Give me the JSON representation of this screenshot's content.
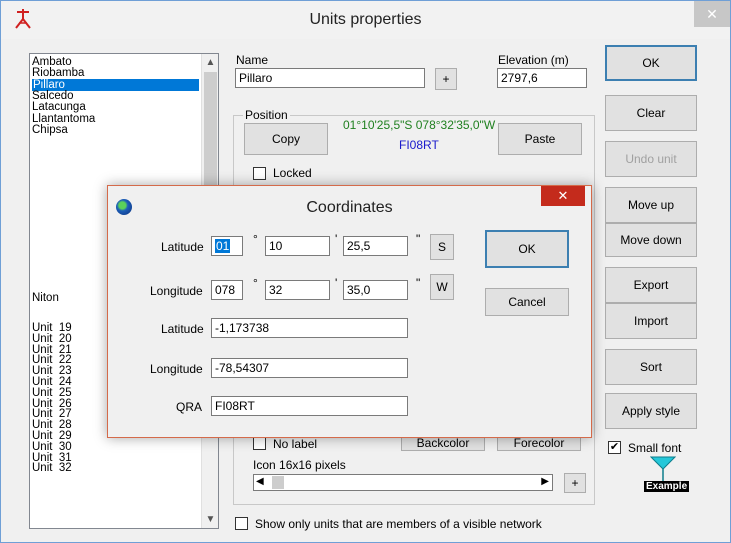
{
  "window": {
    "title": "Units properties",
    "close_glyph": "✕"
  },
  "unit_list": {
    "top_items": [
      "Ambato",
      "Riobamba",
      "Pillaro",
      "Salcedo",
      "Latacunga",
      "Llantantoma",
      "Chipsa"
    ],
    "selected_index": 2,
    "middle_item": "Niton",
    "units": [
      "Unit  19",
      "Unit  20",
      "Unit  21",
      "Unit  22",
      "Unit  23",
      "Unit  24",
      "Unit  25",
      "Unit  26",
      "Unit  27",
      "Unit  28",
      "Unit  29",
      "Unit  30",
      "Unit  31",
      "Unit  32"
    ]
  },
  "form": {
    "name_label": "Name",
    "name_value": "Pillaro",
    "name_plus": "+",
    "elevation_label": "Elevation (m)",
    "elevation_value": "2797,6",
    "position_group": "Position",
    "position_coords": "01°10'25,5\"S 078°32'35,0\"W",
    "position_qra": "FI08RT",
    "copy_label": "Copy",
    "paste_label": "Paste",
    "locked_label": "Locked",
    "no_label": "No label",
    "backcolor_label": "Backcolor",
    "forecolor_label": "Forecolor",
    "icon_label": "Icon 16x16 pixels",
    "icon_plus": "+",
    "show_only_label": "Show only units that are members of a visible network"
  },
  "right_buttons": {
    "ok": "OK",
    "clear": "Clear",
    "undo": "Undo unit",
    "move_up": "Move up",
    "move_down": "Move down",
    "export": "Export",
    "import": "Import",
    "sort": "Sort",
    "apply_style": "Apply style"
  },
  "small_font": {
    "label": "Small font",
    "checked": "✔",
    "example_label": "Example"
  },
  "coordinates_dialog": {
    "title": "Coordinates",
    "close_glyph": "✕",
    "latitude_label": "Latitude",
    "lat_deg": "01",
    "lat_min": "10",
    "lat_sec": "25,5",
    "lat_hemi": "S",
    "longitude_label": "Longitude",
    "lon_deg": "078",
    "lon_min": "32",
    "lon_sec": "35,0",
    "lon_hemi": "W",
    "deg_symbol": "°",
    "min_symbol": "'",
    "sec_symbol": "\"",
    "latitude_decimal_label": "Latitude",
    "latitude_decimal": "-1,173738",
    "longitude_decimal_label": "Longitude",
    "longitude_decimal": "-78,54307",
    "qra_label": "QRA",
    "qra_value": "FI08RT",
    "ok": "OK",
    "cancel": "Cancel"
  },
  "colors": {
    "accent": "#0078d7",
    "coords_green": "#208020",
    "qra_blue": "#1a1acc",
    "close_red": "#c42b1c",
    "marker_cyan": "#25c7d9"
  },
  "icons": [
    "app-antenna-icon",
    "globe-icon",
    "close-icon",
    "scroll-up-icon",
    "scroll-down-icon",
    "scroll-left-icon",
    "scroll-right-icon",
    "triangle-marker-icon"
  ]
}
